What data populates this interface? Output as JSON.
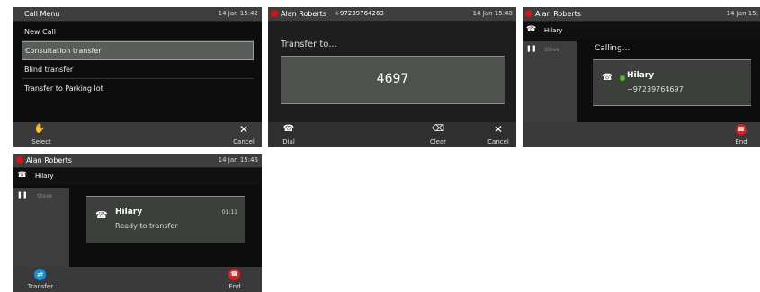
{
  "screen1": {
    "title": "Call Menu",
    "date": "14 Jan 15:42",
    "items": [
      "New Call",
      "Consultation transfer",
      "Blind transfer",
      "Transfer to Parking lot"
    ],
    "softkeys": {
      "select": "Select",
      "cancel": "Cancel"
    },
    "icons": {
      "select": "✋",
      "cancel": "✕"
    }
  },
  "screen2": {
    "caller": "Alan Roberts",
    "number": "+97239764263",
    "date": "14 Jan 15:48",
    "prompt": "Transfer to...",
    "input_value": "4697",
    "softkeys": {
      "dial": "Dial",
      "clear": "Clear",
      "cancel": "Cancel"
    },
    "icons": {
      "dial": "☎",
      "clear": "⌫",
      "cancel": "✕"
    }
  },
  "screen3": {
    "caller": "Alan Roberts",
    "date": "14 Jan 15:",
    "active_call": "Hilary",
    "held_call": "Steve",
    "status": "Calling...",
    "card_name": "Hilary",
    "card_number": "+97239764697",
    "softkeys": {
      "end": "End"
    },
    "icons": {
      "phone": "☎",
      "pause": "❚❚",
      "end": "☎"
    }
  },
  "screen4": {
    "caller": "Alan Roberts",
    "date": "14 Jan 15:46",
    "active_call": "Hilary",
    "held_call": "Steve",
    "card_name": "Hilary",
    "card_status": "Ready to transfer",
    "card_timer": "01:11",
    "softkeys": {
      "transfer": "Transfer",
      "end": "End"
    },
    "icons": {
      "phone": "☎",
      "pause": "❚❚",
      "transfer": "⇄",
      "end": "☎"
    }
  },
  "colors": {
    "record_dot": "#e01010",
    "end_button": "#e02020",
    "transfer_button": "#1a8fd8",
    "presence": "#4cc020"
  }
}
